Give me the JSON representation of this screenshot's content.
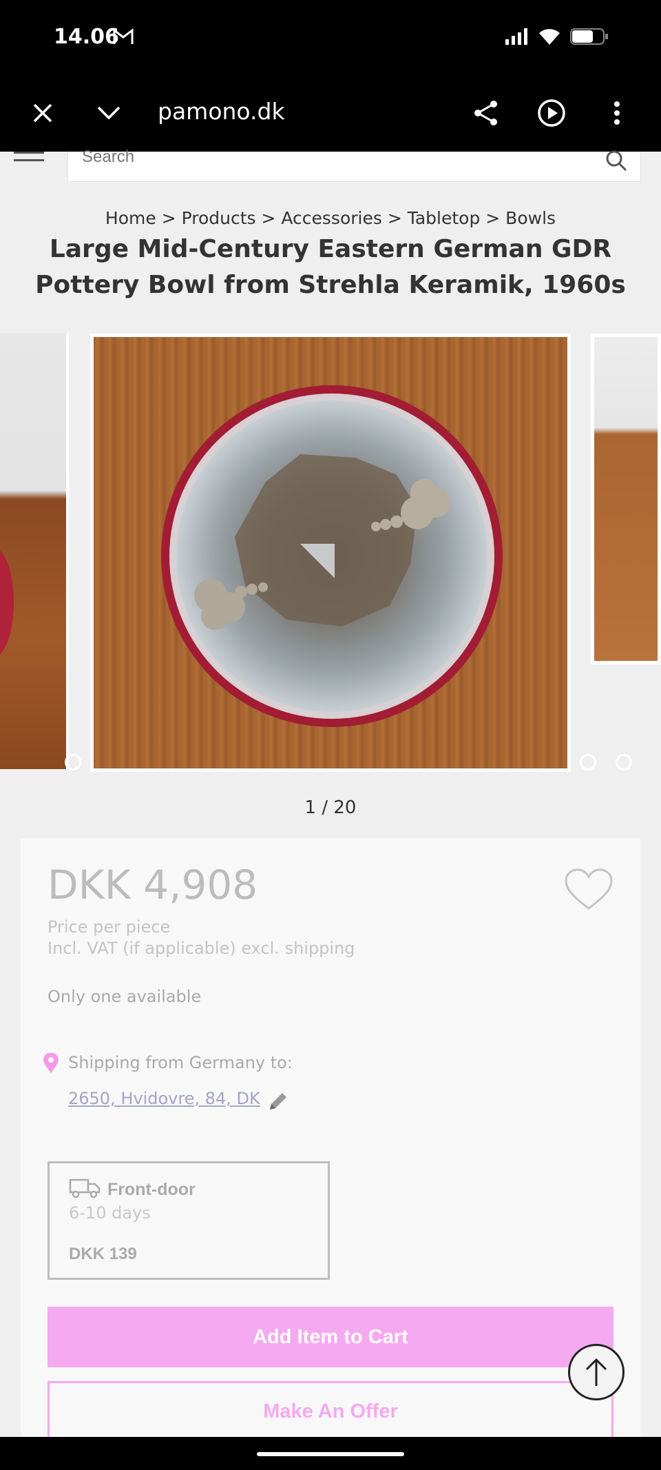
{
  "status_bar": {
    "time": "14.06",
    "icons": [
      "gmail-icon",
      "signal-icon",
      "wifi-icon",
      "battery-icon"
    ]
  },
  "browser": {
    "url": "pamono.dk",
    "icons": [
      "close-icon",
      "chevron-down-icon",
      "share-icon",
      "play-icon",
      "more-icon"
    ]
  },
  "header": {
    "search_placeholder": "Search"
  },
  "breadcrumb": "Home > Products > Accessories > Tabletop > Bowls",
  "product": {
    "title": "Large Mid-Century Eastern German GDR Pottery Bowl from Strehla Keramik, 1960s",
    "image_counter": "1 / 20",
    "price": "DKK 4,908",
    "price_per": "Price per piece",
    "price_vat": "Incl. VAT (if applicable) excl. shipping",
    "availability": "Only one available"
  },
  "shipping": {
    "label": "Shipping from Germany to:",
    "address": "2650, Hvidovre, 84, DK",
    "option": {
      "type": "Front-door",
      "days": "6-10 days",
      "price": "DKK 139"
    }
  },
  "actions": {
    "add_to_cart": "Add Item to Cart",
    "make_offer": "Make An Offer"
  },
  "colors": {
    "accent_pink": "#f5a9f0",
    "pin_pink": "#f39be8",
    "link": "#a4a4c8"
  }
}
